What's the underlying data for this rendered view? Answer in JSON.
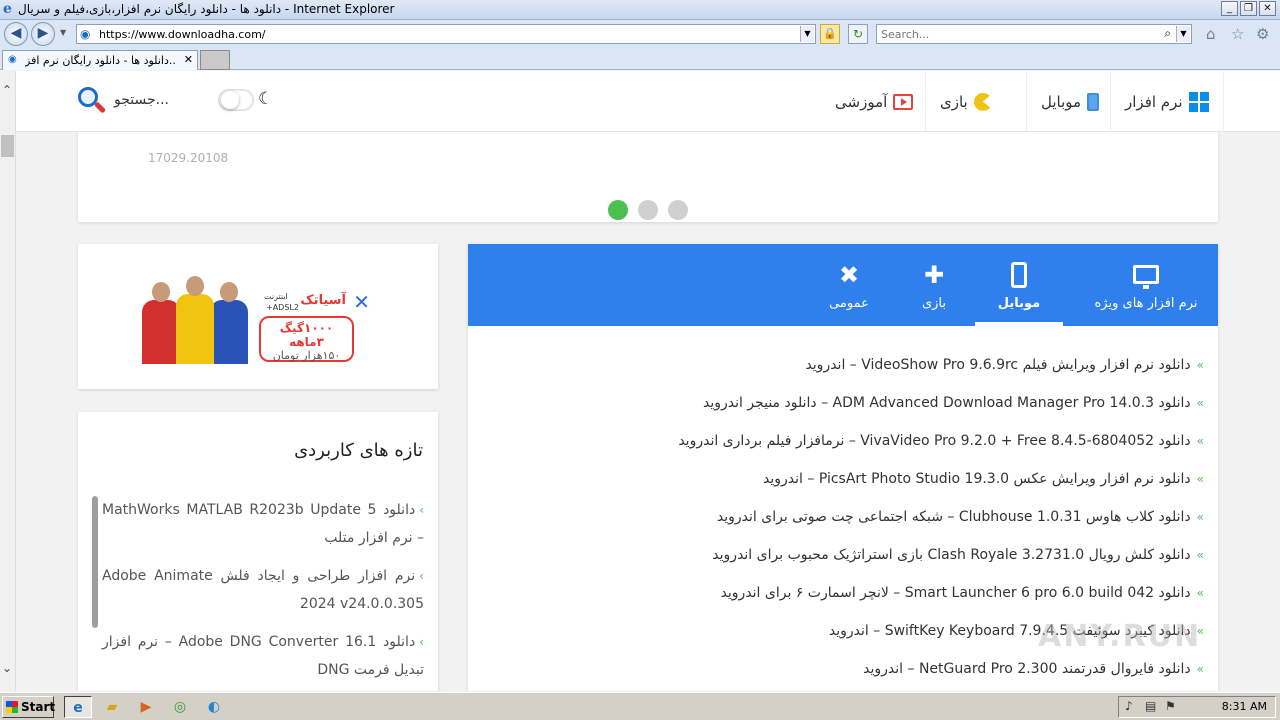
{
  "window": {
    "title": "دانلود ها - دانلود رایگان نرم افزار،بازی،فیلم و سریال - Internet Explorer",
    "controls": [
      "_",
      "❐",
      "✕"
    ]
  },
  "address_bar": {
    "url": "https://www.downloadha.com/",
    "search_placeholder": "Search..."
  },
  "tab": {
    "label": "دانلود ها - دانلود رایگان نرم افز...",
    "close": "✕"
  },
  "site_header": {
    "nav": [
      {
        "label": "نرم افزار",
        "icon": "windows-icon"
      },
      {
        "label": "موبایل",
        "icon": "phone-icon"
      },
      {
        "label": "بازی",
        "icon": "pacman-icon"
      },
      {
        "label": "آموزشی",
        "icon": "video-icon"
      }
    ],
    "search_label": "جستجو...",
    "theme_icon": "☾"
  },
  "slider": {
    "faded_texts": [
      "17029.20108"
    ],
    "dots": 3,
    "active_dot": 0
  },
  "ad": {
    "brand": "آسیاتک",
    "tag": "اینترنت",
    "product": "ADSL2+",
    "price_line1": "۱۰۰۰گیگ ۳ماهه",
    "price_line2": "۱۵۰هزار تومان"
  },
  "latest": {
    "title": "تازه های کاربردی",
    "items": [
      "دانلود MathWorks MATLAB R2023b Update 5 – نرم افزار متلب",
      "نرم افزار طراحی و ایجاد فلش Adobe Animate 2024 v24.0.0.305",
      "دانلود Adobe DNG Converter 16.1 – نرم افزار تبدیل فرمت DNG"
    ]
  },
  "mobile_box": {
    "tabs": [
      {
        "label": "نرم افزار های ویژه",
        "icon": "monitor-icon"
      },
      {
        "label": "موبایل",
        "icon": "phone-icon"
      },
      {
        "label": "بازی",
        "icon": "gamepad-icon"
      },
      {
        "label": "عمومی",
        "icon": "tools-icon"
      }
    ],
    "active_tab": "موبایل",
    "posts": [
      "دانلود نرم افزار ویرایش فیلم VideoShow Pro 9.6.9rc – اندروید",
      "دانلود ADM Advanced Download Manager Pro 14.0.3 – دانلود منیجر اندروید",
      "دانلود VivaVideo Pro 9.2.0 + Free 8.4.5-6804052 – نرمافزار فیلم برداری اندروید",
      "دانلود نرم افزار ویرایش عکس PicsArt Photo Studio 19.3.0 – اندروید",
      "دانلود کلاب هاوس Clubhouse 1.0.31 – شبکه اجتماعی چت صوتی برای اندروید",
      "دانلود کلش رویال Clash Royale 3.2731.0 بازی استراتژیک محبوب برای اندروید",
      "دانلود Smart Launcher 6 pro 6.0 build 042 – لانچر اسمارت ۶ برای اندروید",
      "دانلود کیبرد سوئیفت SwiftKey Keyboard 7.9.4.5 – اندروید",
      "دانلود فایروال قدرتمند NetGuard Pro 2.300 – اندروید"
    ]
  },
  "watermark": "ANY.RUN",
  "taskbar": {
    "start_label": "Start",
    "clock": "8:31 AM"
  }
}
